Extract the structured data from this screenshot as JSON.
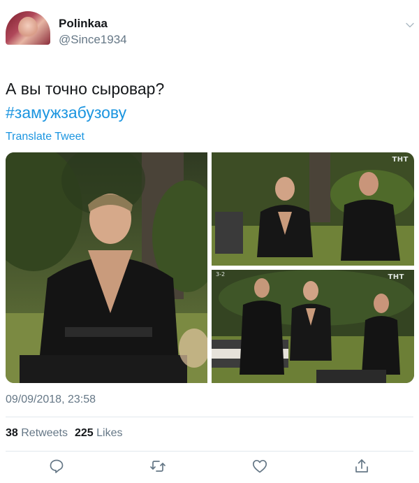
{
  "user": {
    "display_name": "Polinkaa",
    "handle": "@Since1934"
  },
  "tweet": {
    "text": "А вы точно сыровар?",
    "hashtag": "#замужзабузову",
    "translate_label": "Translate Tweet",
    "timestamp": "09/09/2018, 23:58"
  },
  "media": {
    "channel_badge": "ТНТ",
    "episode_marker": "3-2"
  },
  "stats": {
    "retweets_count": "38",
    "retweets_label": "Retweets",
    "likes_count": "225",
    "likes_label": "Likes"
  },
  "colors": {
    "link": "#1b95e0",
    "secondary_text": "#657786",
    "divider": "#e1e8ed"
  },
  "icons": [
    "chevron-down-icon",
    "reply-icon",
    "retweet-icon",
    "like-icon",
    "share-icon"
  ]
}
